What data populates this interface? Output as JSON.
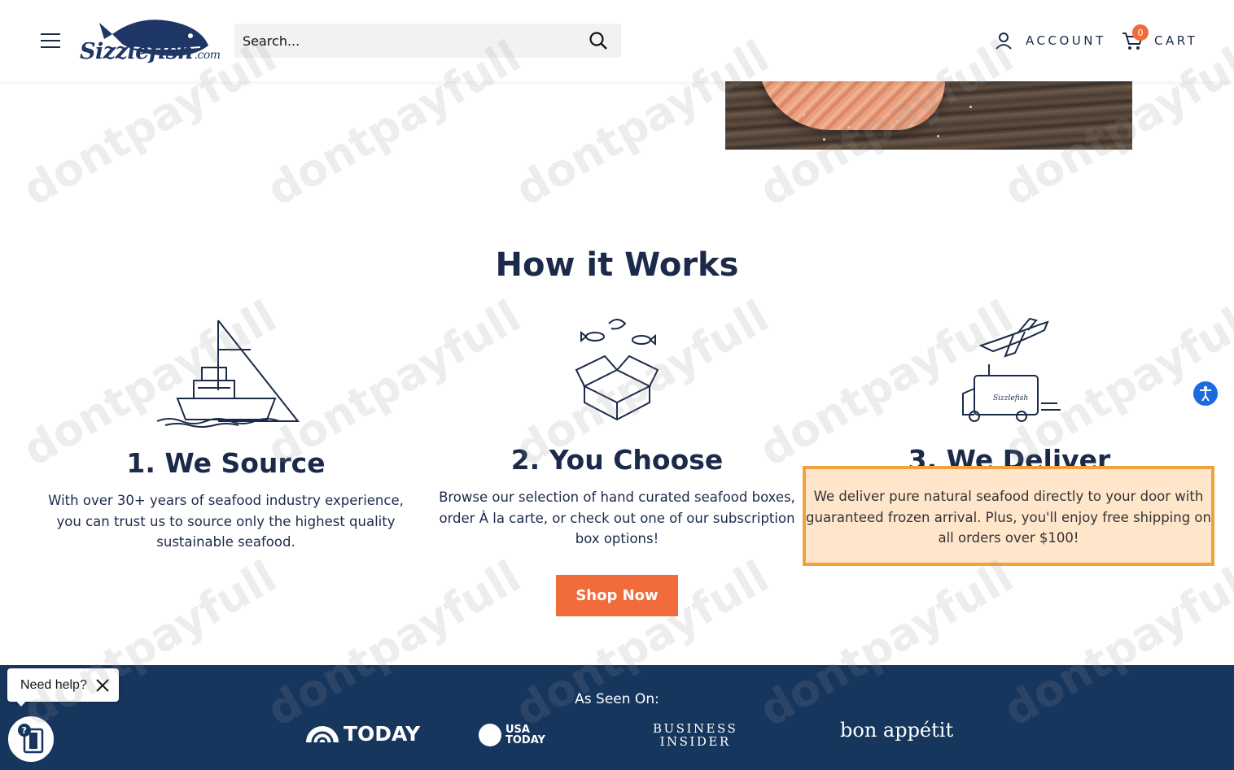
{
  "header": {
    "menu_icon": "hamburger-menu-icon",
    "logo_text": "Sizzlefish",
    "logo_suffix": ".com",
    "search_placeholder": "Search...",
    "account_label": "ACCOUNT",
    "cart_label": "CART",
    "cart_count": "0"
  },
  "main": {
    "section_title": "How it Works",
    "steps": [
      {
        "icon": "fishing-boat-icon",
        "title": "1. We Source",
        "description": "With over 30+ years of seafood industry experience, you can trust us to source only the highest quality sustainable seafood."
      },
      {
        "icon": "open-box-seafood-icon",
        "title": "2. You Choose",
        "description": "Browse our selection of hand curated seafood boxes, order À la carte, or check out one of our subscription box options!"
      },
      {
        "icon": "plane-truck-delivery-icon",
        "title": "3. We Deliver",
        "description": "We deliver pure natural seafood directly to your door with guaranteed frozen arrival. Plus, you'll enjoy free shipping on all orders over $100!"
      }
    ],
    "cta_label": "Shop Now"
  },
  "footer": {
    "as_seen_on": "As Seen On:",
    "press": {
      "today": "TODAY",
      "usa_today_line1": "USA",
      "usa_today_line2": "TODAY",
      "business_insider_line1": "BUSINESS",
      "business_insider_line2": "INSIDER",
      "bon_appetit": "bon appétit"
    }
  },
  "help_widget": {
    "label": "Need help?"
  },
  "watermark": "dontpayfull",
  "colors": {
    "navy": "#1b2a4a",
    "band": "#17365e",
    "accent_orange": "#f26b3a",
    "highlight_border": "#f0a23e",
    "highlight_fill": "#ffe2c4",
    "accessibility_blue": "#1b6be0"
  }
}
